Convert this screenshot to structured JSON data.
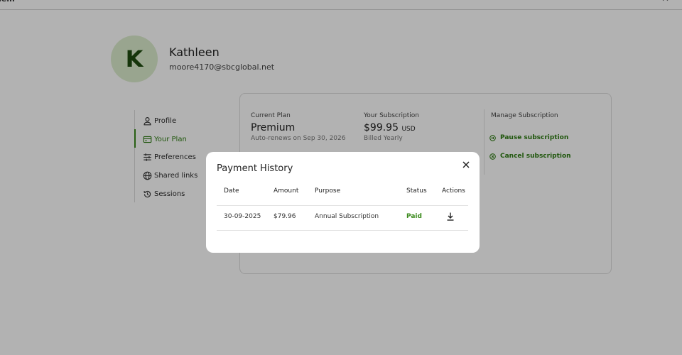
{
  "window": {
    "title": "hem",
    "close_glyph": "✕"
  },
  "profile": {
    "avatar_initial": "K",
    "name": "Kathleen",
    "email": "moore4170@sbcglobal.net"
  },
  "nav": {
    "items": [
      {
        "label": "Profile",
        "icon": "person-icon"
      },
      {
        "label": "Your Plan",
        "icon": "card-icon",
        "active": true
      },
      {
        "label": "Preferences",
        "icon": "sliders-icon"
      },
      {
        "label": "Shared links",
        "icon": "globe-icon"
      },
      {
        "label": "Sessions",
        "icon": "history-icon"
      }
    ]
  },
  "plan": {
    "current_plan_label": "Current Plan",
    "current_plan_value": "Premium",
    "renewal_text": "Auto-renews on Sep 30, 2026",
    "subscription_label": "Your Subscription",
    "subscription_price": "$99.95",
    "subscription_currency": "USD",
    "billing_cycle": "Billed Yearly",
    "manage_title": "Manage Subscription",
    "pause_label": "Pause subscription",
    "cancel_label": "Cancel subscription"
  },
  "modal": {
    "title": "Payment History",
    "columns": [
      "Date",
      "Amount",
      "Purpose",
      "Status",
      "Actions"
    ],
    "rows": [
      {
        "date": "30-09-2025",
        "amount": "$79.96",
        "purpose": "Annual Subscription",
        "status": "Paid",
        "action_icon": "download-icon"
      }
    ]
  },
  "colors": {
    "accent": "#2f7d14",
    "avatar_bg": "#dceccd",
    "overlay": "rgba(0,0,0,0.3)"
  }
}
